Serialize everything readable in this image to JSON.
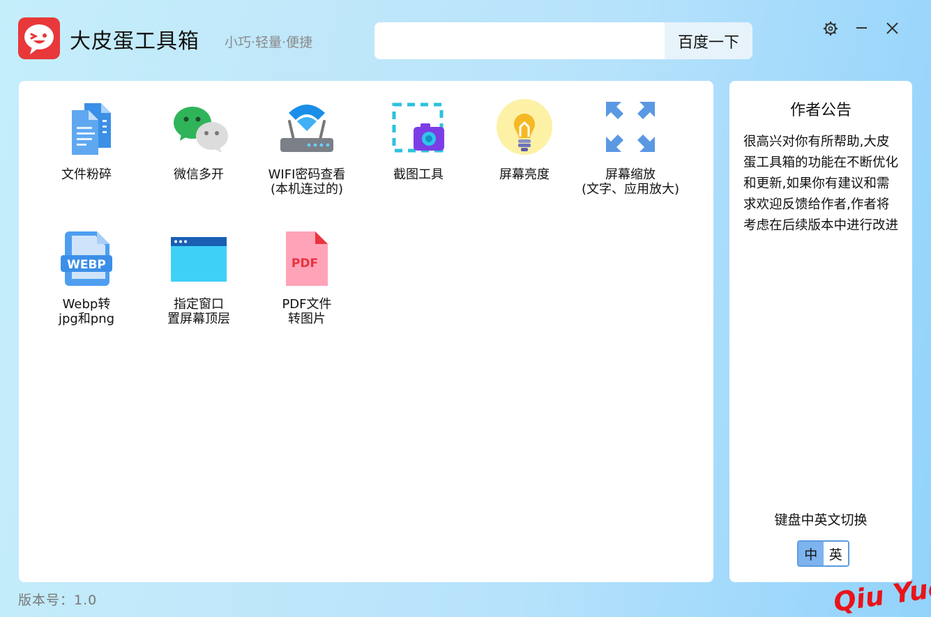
{
  "app": {
    "title": "大皮蛋工具箱",
    "slogan": "小巧·轻量·便捷"
  },
  "search": {
    "value": "",
    "button_label": "百度一下"
  },
  "window_controls": [
    "gear-icon",
    "minimize-icon",
    "close-icon"
  ],
  "tools": [
    {
      "label": "文件粉碎",
      "icon": "file-shred-icon"
    },
    {
      "label": "微信多开",
      "icon": "wechat-icon"
    },
    {
      "label": "WIFI密码查看\n(本机连过的)",
      "icon": "wifi-router-icon"
    },
    {
      "label": "截图工具",
      "icon": "screenshot-icon"
    },
    {
      "label": "屏幕亮度",
      "icon": "lightbulb-icon"
    },
    {
      "label": "屏幕缩放\n(文字、应用放大)",
      "icon": "zoom-arrows-icon"
    },
    {
      "label": "Webp转\njpg和png",
      "icon": "webp-icon"
    },
    {
      "label": "指定窗口\n置屏幕顶层",
      "icon": "window-top-icon"
    },
    {
      "label": "PDF文件\n转图片",
      "icon": "pdf-icon"
    }
  ],
  "notice": {
    "title": "作者公告",
    "body": "很高兴对你有所帮助,大皮蛋工具箱的功能在不断优化和更新,如果你有建议和需求欢迎反馈给作者,作者将考虑在后续版本中进行改进"
  },
  "keyboard": {
    "label": "键盘中英文切换",
    "zh": "中",
    "en": "英"
  },
  "version": "版本号：1.0",
  "watermark": "Qiu Yue",
  "colors": {
    "logo": "#e8383a",
    "accent": "#7db3ee",
    "watermark": "#e8141b"
  }
}
